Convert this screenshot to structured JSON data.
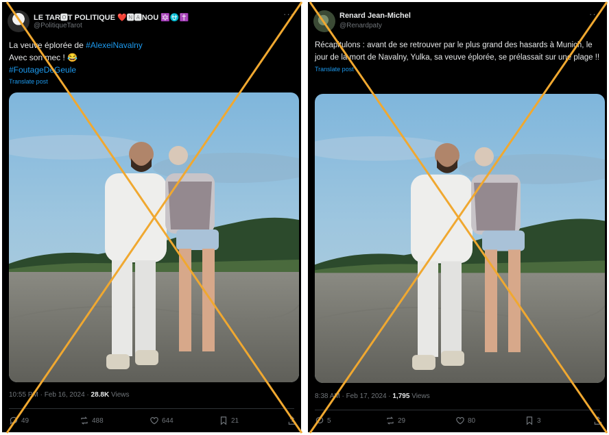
{
  "left": {
    "author": {
      "name": "LE TAR🅾T POLITIQUE ❤️🅽🅰NOU 🔯⛎✝️",
      "handle": "@PolitiqueTarot"
    },
    "text_line1_prefix": "La veuve éplorée de ",
    "text_line1_hashtag": "#AlexeiNavalny",
    "text_line2": "Avec son mec ! 😂",
    "text_line3_hashtag": "#FoutageDeGeule",
    "translate": "Translate post",
    "time": "10:55 PM · Feb 16, 2024 · ",
    "views_count": "28.8K",
    "views_label": " Views",
    "replies": "49",
    "reposts": "488",
    "likes": "644",
    "bookmarks": "21"
  },
  "right": {
    "author": {
      "name": "Renard Jean-Michel",
      "handle": "@Renardpaty"
    },
    "text": "Récapitulons : avant de se retrouver par le plus grand des hasards à Munich, le jour de la mort de Navalny, Yulka, sa veuve éplorée, se prélassait sur une plage !!",
    "translate": "Translate post",
    "time": "8:38 AM · Feb 17, 2024 · ",
    "views_count": "1,795",
    "views_label": " Views",
    "replies": "5",
    "reposts": "29",
    "likes": "80",
    "bookmarks": "3"
  },
  "colors": {
    "background": "#000000",
    "text": "#e7e9ea",
    "muted": "#71767b",
    "link": "#1d9bf0",
    "cross": "#f0a830"
  }
}
